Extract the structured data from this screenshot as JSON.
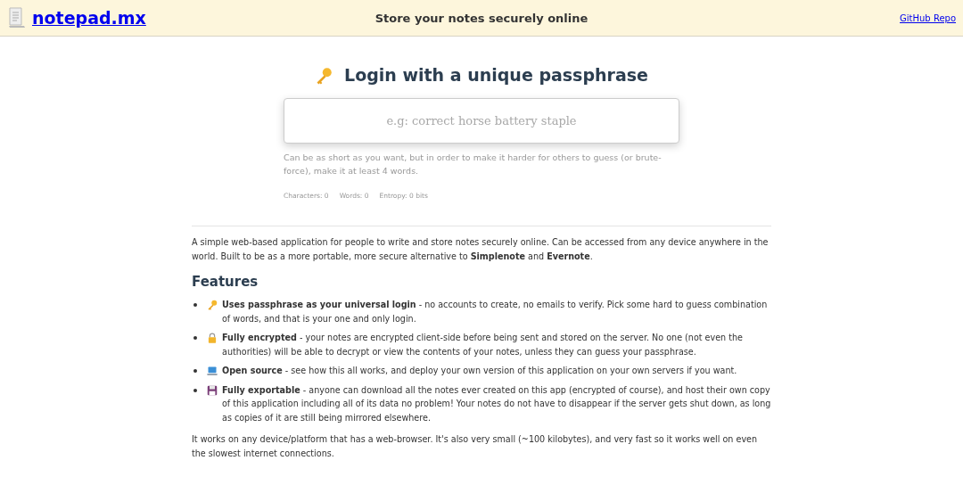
{
  "header": {
    "logo": "notepad.mx",
    "tagline": "Store your notes securely online",
    "repo_link": "GitHub Repo"
  },
  "login": {
    "title": "Login with a unique passphrase",
    "placeholder": "e.g: correct horse battery staple",
    "hint": "Can be as short as you want, but in order to make it harder for others to guess (or brute-force), make it at least 4 words.",
    "stats": [
      "Characters: 0",
      "Words: 0",
      "Entropy: 0 bits"
    ]
  },
  "intro": "A simple web-based application for people to write and store notes securely online. Can be accessed from any device anywhere in the world. Built to be as a more portable, more secure alternative to **Simplenote** and **Evernote**.",
  "features": {
    "heading": "Features",
    "items": [
      {
        "kind": "key",
        "text": "**Uses passphrase as your universal login** - no accounts to create, no emails to verify. Pick some hard to guess combination of words, and that is your one and only login."
      },
      {
        "kind": "lock",
        "text": "**Fully encrypted** - your notes are encrypted client-side before being sent and stored on the server. No one (not even the authorities) will be able to decrypt or view the contents of your notes, unless they can guess your passphrase."
      },
      {
        "kind": "laptop",
        "text": "**Open source** - see how this all works, and deploy your own version of this application on your own servers if you want."
      },
      {
        "kind": "floppy",
        "text": "**Fully exportable** - anyone can download all the notes ever created on this app (encrypted of course), and host their own copy of this application including all of its data no problem! Your notes do not have to disappear if the server gets shut down, as long as copies of it are still being mirrored elsewhere."
      }
    ]
  },
  "outro": "It works on any device/platform that has a web-browser. It's also very small (~100 kilobytes), and very fast so it works well on even the slowest internet connections."
}
